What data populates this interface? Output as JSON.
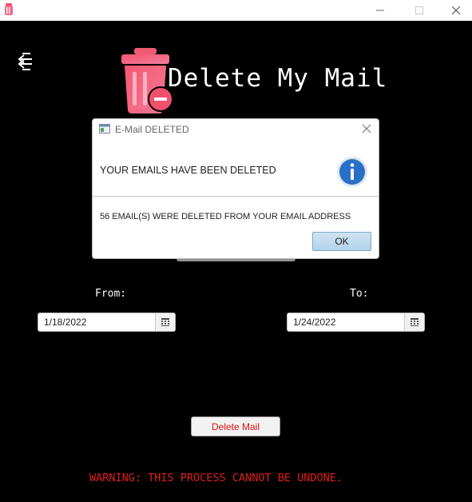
{
  "window": {
    "app_icon": "trash-icon",
    "controls": [
      "minimize-icon",
      "maximize-icon",
      "close-icon"
    ]
  },
  "app": {
    "title": "Delete My Mail",
    "menu_icon": "menu-collapse-icon",
    "logo_icon": "trash-remove-icon",
    "from_label": "From:",
    "to_label": "To:",
    "from_date": "1/18/2022",
    "to_date": "1/24/2022",
    "delete_button": "Delete Mail",
    "warning": "WARNING: THIS PROCESS CANNOT BE UNDONE.",
    "colors": {
      "background": "#000000",
      "warning": "#e21c1c",
      "logo": "#f0506e",
      "delete_text": "#e01010"
    }
  },
  "dialog": {
    "title": "E-Mail DELETED",
    "heading": "YOUR EMAILS HAVE BEEN DELETED",
    "message": "56 EMAIL(S) WERE DELETED FROM YOUR EMAIL ADDRESS",
    "ok_label": "OK",
    "icon": "info-icon",
    "colors": {
      "info": "#2a6fc7",
      "ok_button": "#b2d3ea"
    }
  }
}
